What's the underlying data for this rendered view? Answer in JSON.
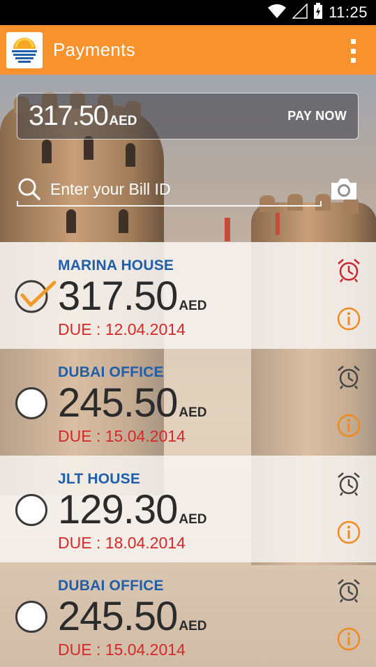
{
  "status_bar": {
    "time": "11:25"
  },
  "app_bar": {
    "title": "Payments"
  },
  "pay": {
    "amount": "317.50",
    "currency": "AED",
    "button_label": "PAY NOW"
  },
  "search": {
    "placeholder": "Enter your Bill ID",
    "value": ""
  },
  "bills": [
    {
      "name": "MARINA HOUSE",
      "amount": "317.50",
      "currency": "AED",
      "due": "DUE : 12.04.2014",
      "selected": true,
      "alarm_color": "#c8262c",
      "info_color": "#ef8a1f"
    },
    {
      "name": "DUBAI OFFICE",
      "amount": "245.50",
      "currency": "AED",
      "due": "DUE : 15.04.2014",
      "selected": false,
      "alarm_color": "#444444",
      "info_color": "#ef8a1f"
    },
    {
      "name": "JLT HOUSE",
      "amount": "129.30",
      "currency": "AED",
      "due": "DUE : 18.04.2014",
      "selected": false,
      "alarm_color": "#444444",
      "info_color": "#ef8a1f"
    },
    {
      "name": "DUBAI OFFICE",
      "amount": "245.50",
      "currency": "AED",
      "due": "DUE : 15.04.2014",
      "selected": false,
      "alarm_color": "#444444",
      "info_color": "#ef8a1f"
    }
  ],
  "colors": {
    "accent": "#f7922d",
    "bill_name": "#1f5ea8",
    "due": "#d42929"
  }
}
